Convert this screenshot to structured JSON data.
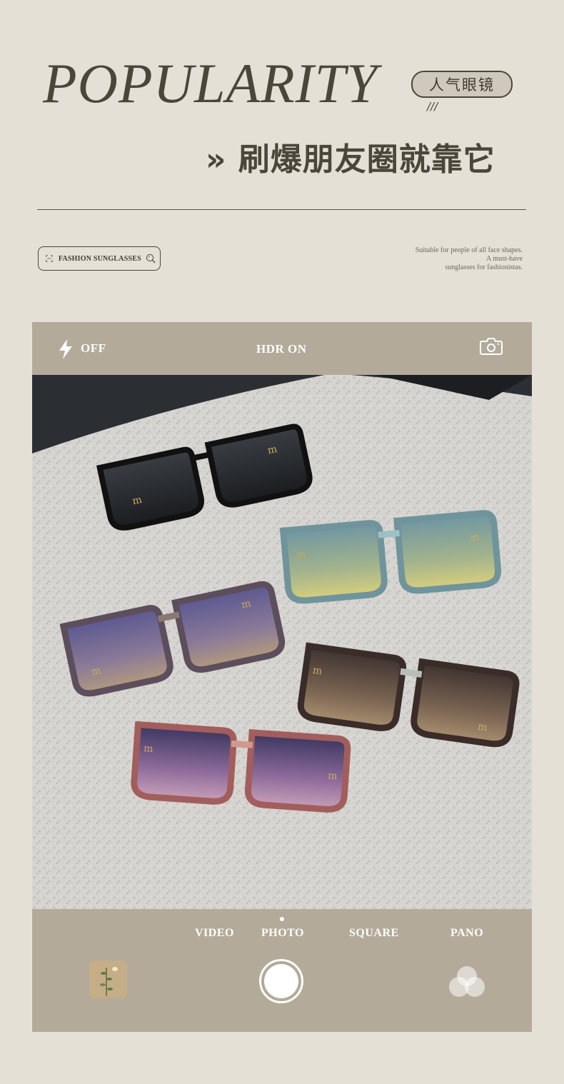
{
  "header": {
    "headline": "POPULARITY",
    "badge": "人气眼镜",
    "slashes": "///",
    "subtitle": "» 刷爆朋友圈就靠它"
  },
  "tag": {
    "label": "FASHION SUNGLASSES"
  },
  "note": {
    "line1": "Suitable for people of all face shapes.",
    "line2": "A must-have",
    "line3": "sunglasses for fashionistas."
  },
  "camera": {
    "flash_label": "OFF",
    "hdr_label": "HDR ON",
    "modes": [
      "VIDEO",
      "PHOTO",
      "SQUARE",
      "PANO"
    ],
    "active_mode": "PHOTO",
    "flash_icon": "lightning-icon",
    "switch_icon": "camera-icon",
    "filter_icon": "filters-icon"
  },
  "colors": {
    "background": "#e4e0d6",
    "camera_bar": "#b3aa99",
    "text_dark": "#4a4639"
  }
}
